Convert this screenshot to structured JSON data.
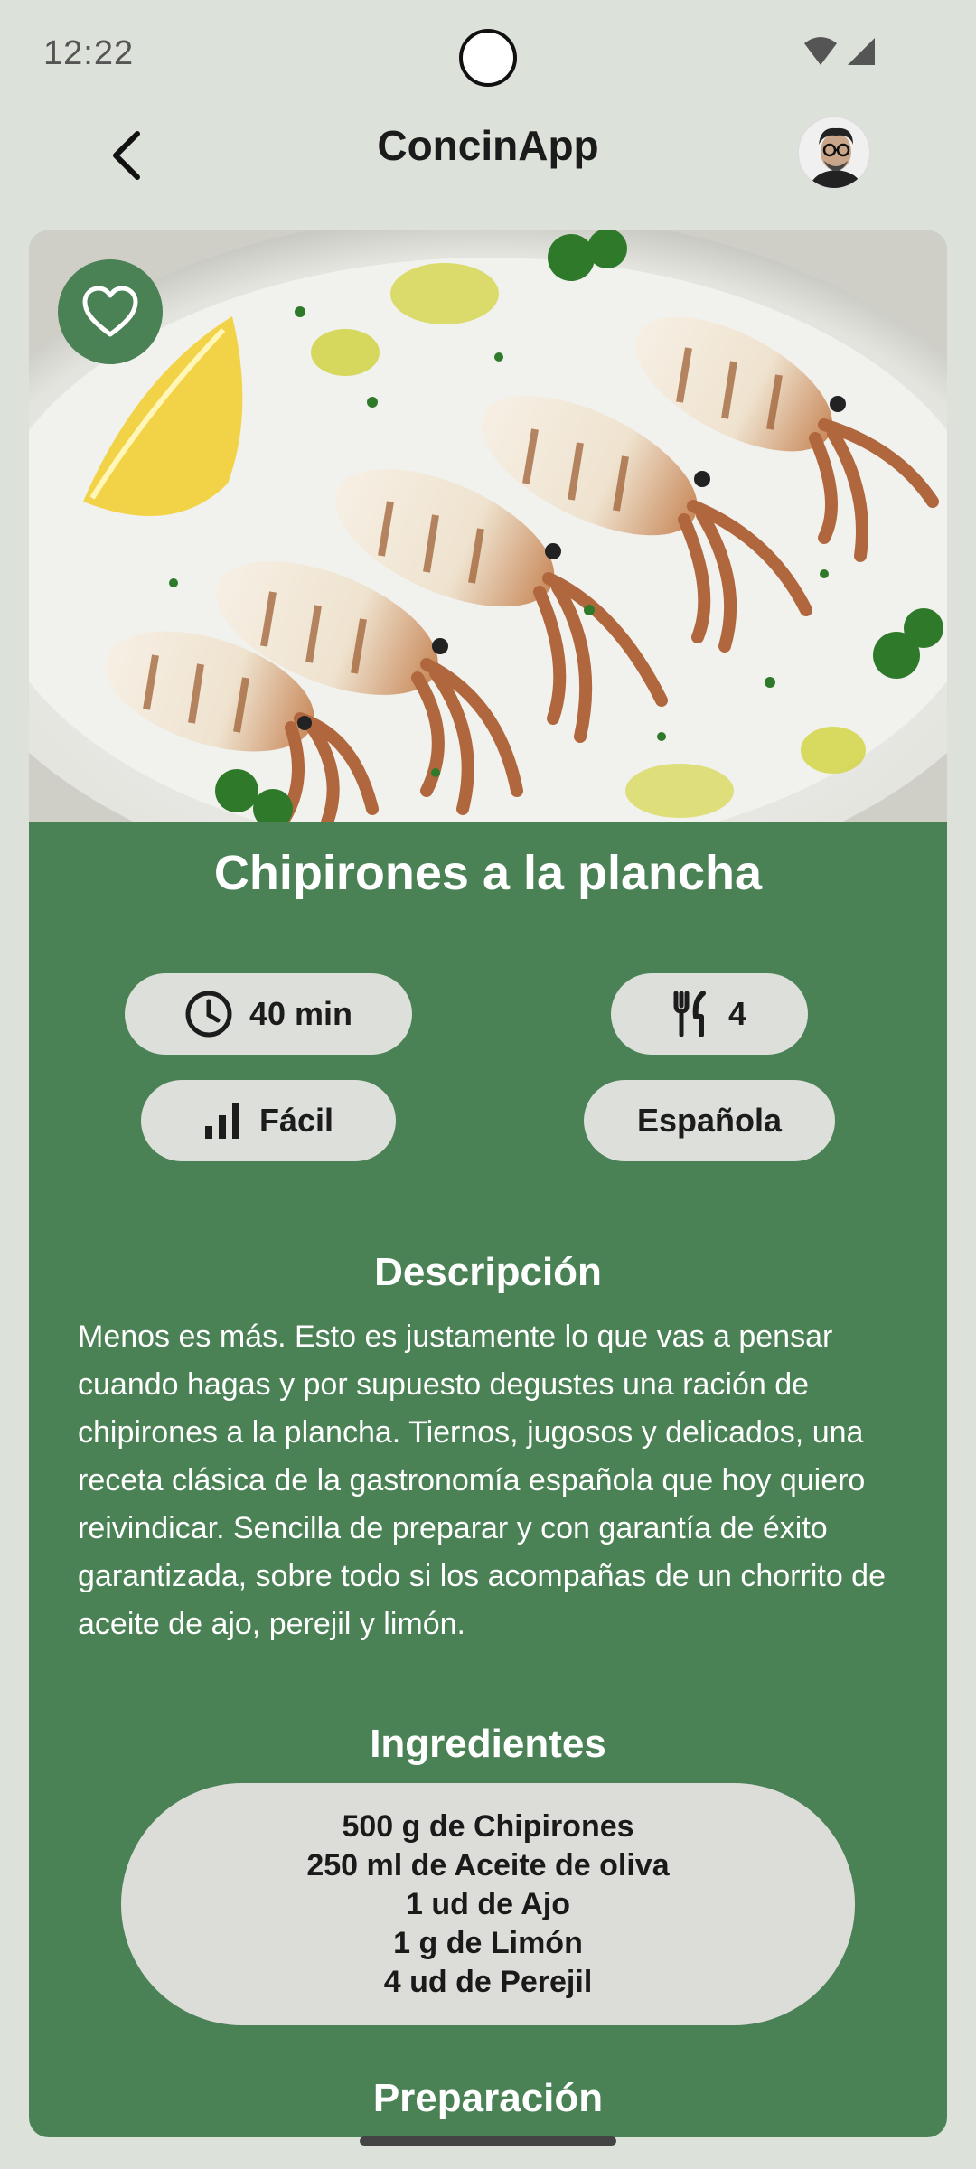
{
  "status": {
    "time": "12:22"
  },
  "header": {
    "title": "ConcinApp"
  },
  "recipe": {
    "title": "Chipirones a la plancha",
    "time": "40 min",
    "servings": "4",
    "difficulty": "Fácil",
    "cuisine": "Española"
  },
  "description": {
    "heading": "Descripción",
    "text": "Menos es más. Esto es justamente lo que vas a pensar cuando hagas y por supuesto degustes una ración de chipirones a la plancha. Tiernos, jugosos y delicados, una receta clásica de la gastronomía española que hoy quiero reivindicar. Sencilla de preparar y con garantía de éxito garantizada, sobre todo si los acompañas de un chorrito de aceite de ajo, perejil y limón."
  },
  "ingredients": {
    "heading": "Ingredientes",
    "items": [
      "500 g de Chipirones",
      "250 ml de Aceite de oliva",
      "1 ud de Ajo",
      "1 g de Limón",
      "4 ud de Perejil"
    ]
  },
  "preparation": {
    "heading": "Preparación"
  },
  "colors": {
    "accent": "#4a8155",
    "chip": "#dddfda",
    "background": "#dce2d9"
  }
}
